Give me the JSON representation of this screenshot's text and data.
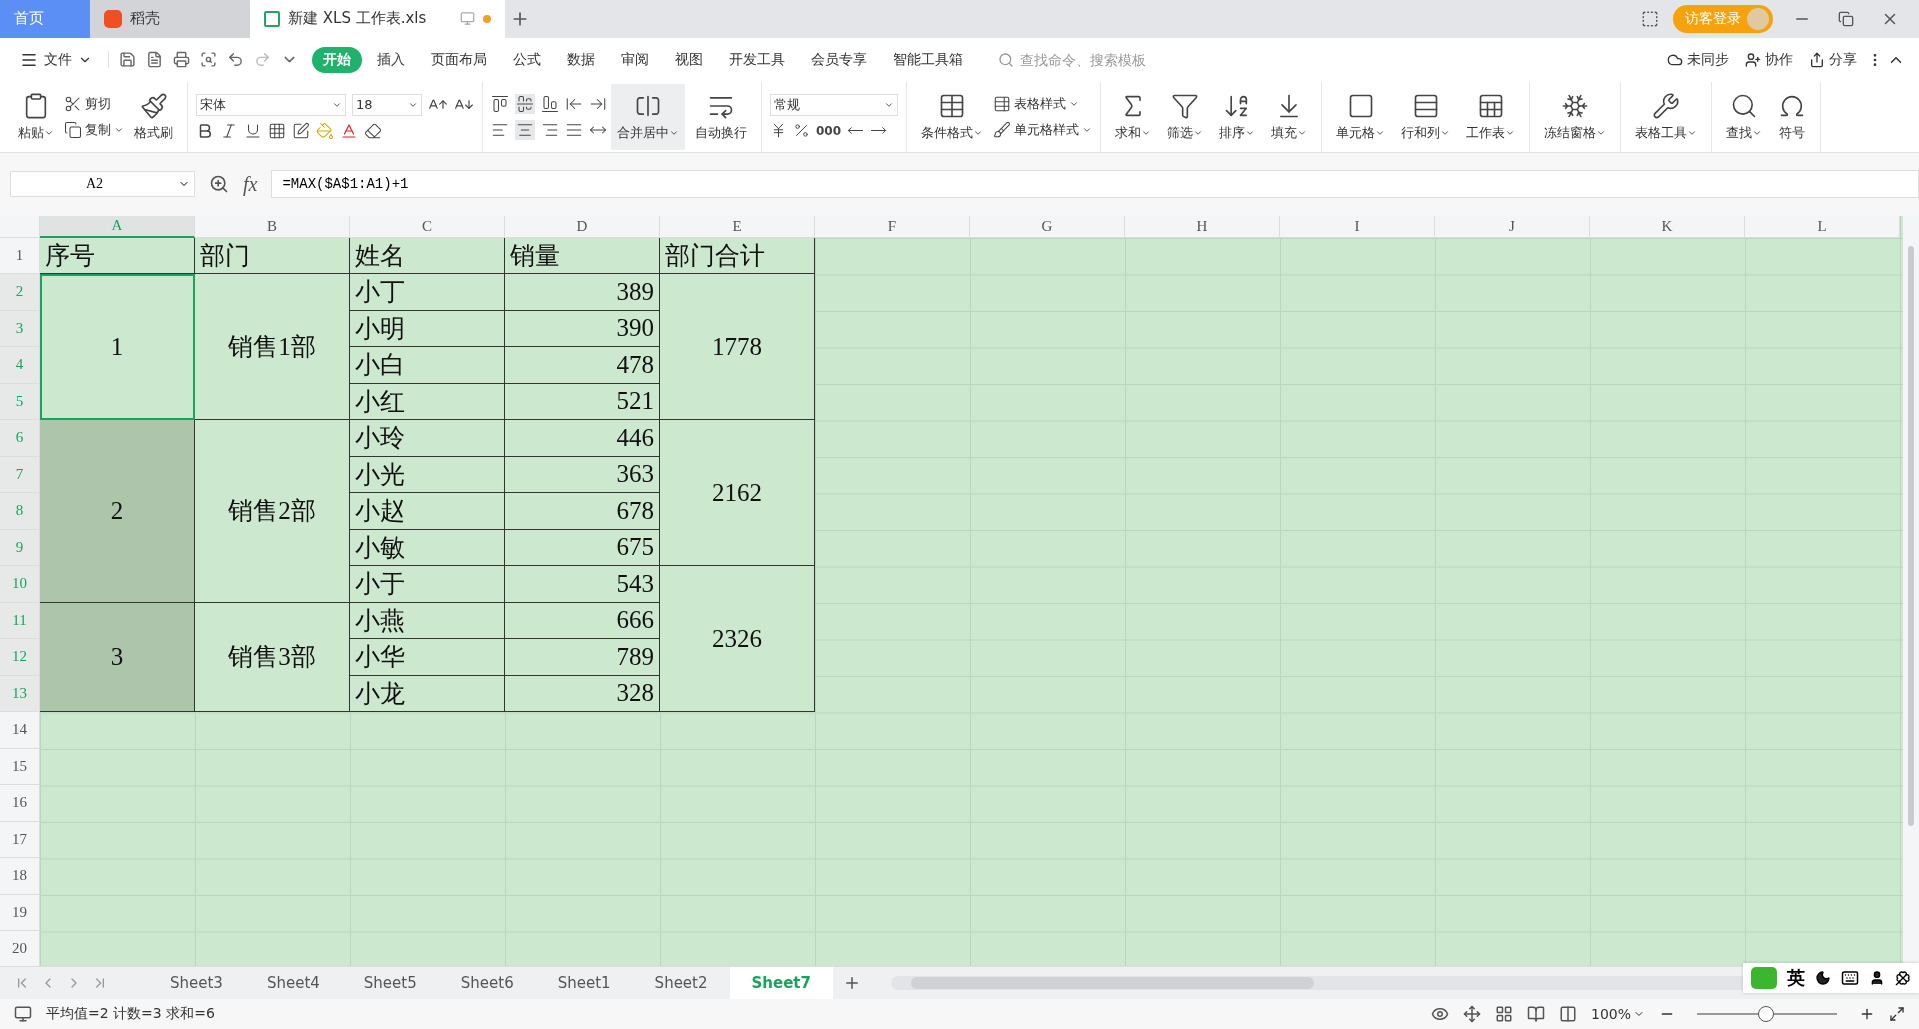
{
  "title_bar": {
    "tabs": [
      {
        "kind": "home",
        "label": "首页",
        "selected": false,
        "modified": false
      },
      {
        "kind": "app",
        "label": "稻壳",
        "selected": false,
        "modified": false
      },
      {
        "kind": "doc",
        "label": "新建 XLS 工作表.xls",
        "selected": true,
        "modified": true
      }
    ],
    "login": "访客登录"
  },
  "menu": {
    "file": "文件",
    "tabs": [
      {
        "label": "开始",
        "selected": true
      },
      {
        "label": "插入",
        "selected": false
      },
      {
        "label": "页面布局",
        "selected": false
      },
      {
        "label": "公式",
        "selected": false
      },
      {
        "label": "数据",
        "selected": false
      },
      {
        "label": "审阅",
        "selected": false
      },
      {
        "label": "视图",
        "selected": false
      },
      {
        "label": "开发工具",
        "selected": false
      },
      {
        "label": "会员专享",
        "selected": false
      },
      {
        "label": "智能工具箱",
        "selected": false
      }
    ],
    "search": {
      "placeholder": "查找命令、搜索模板"
    },
    "actions": [
      "未同步",
      "协作",
      "分享"
    ]
  },
  "ribbon": [
    {
      "items": [
        {
          "kind": "big",
          "label": "粘贴",
          "dropdown": true,
          "highlighted": false
        },
        {
          "kind": "pair",
          "items": [
            {
              "label": "剪切",
              "dropdown": false
            },
            {
              "label": "复制",
              "dropdown": true
            }
          ]
        },
        {
          "kind": "big",
          "label": "格式刷",
          "dropdown": false,
          "highlighted": false
        }
      ]
    },
    {
      "items": [
        {
          "kind": "font",
          "font": "宋体",
          "size": "18"
        }
      ]
    },
    {
      "items": [
        {
          "kind": "align"
        },
        {
          "kind": "big",
          "label": "合并居中",
          "dropdown": true,
          "highlighted": true
        },
        {
          "kind": "big",
          "label": "自动换行",
          "dropdown": false,
          "highlighted": false
        }
      ]
    },
    {
      "items": [
        {
          "kind": "number",
          "format": "常规",
          "thousands": "000"
        }
      ]
    },
    {
      "items": [
        {
          "kind": "big",
          "label": "条件格式",
          "dropdown": true,
          "highlighted": false
        },
        {
          "kind": "pair",
          "items": [
            {
              "label": "表格样式",
              "dropdown": true
            },
            {
              "label": "单元格样式",
              "dropdown": true
            }
          ]
        }
      ]
    },
    {
      "items": [
        {
          "kind": "big",
          "label": "求和",
          "dropdown": true,
          "highlighted": false
        },
        {
          "kind": "big",
          "label": "筛选",
          "dropdown": true,
          "highlighted": false
        },
        {
          "kind": "big",
          "label": "排序",
          "dropdown": true,
          "highlighted": false
        },
        {
          "kind": "big",
          "label": "填充",
          "dropdown": true,
          "highlighted": false
        }
      ]
    },
    {
      "items": [
        {
          "kind": "big",
          "label": "单元格",
          "dropdown": true,
          "highlighted": false
        },
        {
          "kind": "big",
          "label": "行和列",
          "dropdown": true,
          "highlighted": false
        },
        {
          "kind": "big",
          "label": "工作表",
          "dropdown": true,
          "highlighted": false
        }
      ]
    },
    {
      "items": [
        {
          "kind": "big",
          "label": "冻结窗格",
          "dropdown": true,
          "highlighted": false
        }
      ]
    },
    {
      "items": [
        {
          "kind": "big",
          "label": "表格工具",
          "dropdown": true,
          "highlighted": false
        }
      ]
    },
    {
      "items": [
        {
          "kind": "big",
          "label": "查找",
          "dropdown": true,
          "highlighted": false
        },
        {
          "kind": "big",
          "label": "符号",
          "dropdown": false,
          "highlighted": false
        }
      ]
    }
  ],
  "formula_bar": {
    "name_box": "A2",
    "fx": "fx",
    "formula": "=MAX($A$1:A1)+1"
  },
  "sheet": {
    "columns": [
      {
        "label": "A",
        "selected": true
      },
      {
        "label": "B",
        "selected": false
      },
      {
        "label": "C",
        "selected": false
      },
      {
        "label": "D",
        "selected": false
      },
      {
        "label": "E",
        "selected": false
      },
      {
        "label": "F",
        "selected": false
      },
      {
        "label": "G",
        "selected": false
      },
      {
        "label": "H",
        "selected": false
      },
      {
        "label": "I",
        "selected": false
      },
      {
        "label": "J",
        "selected": false
      },
      {
        "label": "K",
        "selected": false
      },
      {
        "label": "L",
        "selected": false
      }
    ],
    "row_numbers": [
      {
        "label": "1",
        "selected": false
      },
      {
        "label": "2",
        "selected": true
      },
      {
        "label": "3",
        "selected": true
      },
      {
        "label": "4",
        "selected": true
      },
      {
        "label": "5",
        "selected": true
      },
      {
        "label": "6",
        "selected": true
      },
      {
        "label": "7",
        "selected": true
      },
      {
        "label": "8",
        "selected": true
      },
      {
        "label": "9",
        "selected": true
      },
      {
        "label": "10",
        "selected": true
      },
      {
        "label": "11",
        "selected": true
      },
      {
        "label": "12",
        "selected": true
      },
      {
        "label": "13",
        "selected": true
      },
      {
        "label": "14",
        "selected": false
      },
      {
        "label": "15",
        "selected": false
      },
      {
        "label": "16",
        "selected": false
      },
      {
        "label": "17",
        "selected": false
      },
      {
        "label": "18",
        "selected": false
      },
      {
        "label": "19",
        "selected": false
      },
      {
        "label": "20",
        "selected": false
      }
    ],
    "header": [
      "序号",
      "部门",
      "姓名",
      "销量",
      "部门合计"
    ],
    "rows": [
      {
        "seq": {
          "text": "1",
          "selected": true,
          "active": true
        },
        "dept": "销售1部",
        "name": "小丁",
        "sales": "389",
        "total": "1778"
      },
      {
        "name": "小明",
        "sales": "390"
      },
      {
        "name": "小白",
        "sales": "478"
      },
      {
        "name": "小红",
        "sales": "521"
      },
      {
        "seq": {
          "text": "2",
          "selected": true,
          "active": false
        },
        "dept": "销售2部",
        "name": "小玲",
        "sales": "446",
        "total": "2162"
      },
      {
        "name": "小光",
        "sales": "363"
      },
      {
        "name": "小赵",
        "sales": "678"
      },
      {
        "name": "小敏",
        "sales": "675"
      },
      {
        "name": "小于",
        "sales": "543",
        "total": "2326"
      },
      {
        "seq": {
          "text": "3",
          "selected": true,
          "active": false
        },
        "dept": "销售3部",
        "name": "小燕",
        "sales": "666"
      },
      {
        "name": "小华",
        "sales": "789"
      },
      {
        "name": "小龙",
        "sales": "328"
      }
    ]
  },
  "sheet_tabs": [
    {
      "label": "Sheet3",
      "selected": false
    },
    {
      "label": "Sheet4",
      "selected": false
    },
    {
      "label": "Sheet5",
      "selected": false
    },
    {
      "label": "Sheet6",
      "selected": false
    },
    {
      "label": "Sheet1",
      "selected": false
    },
    {
      "label": "Sheet2",
      "selected": false
    },
    {
      "label": "Sheet7",
      "selected": true
    }
  ],
  "status_bar": {
    "summary": "平均值=2 计数=3 求和=6",
    "zoom": "100%",
    "zoom_slider": {
      "level": 0.49
    }
  },
  "ime": {
    "label": "英"
  }
}
